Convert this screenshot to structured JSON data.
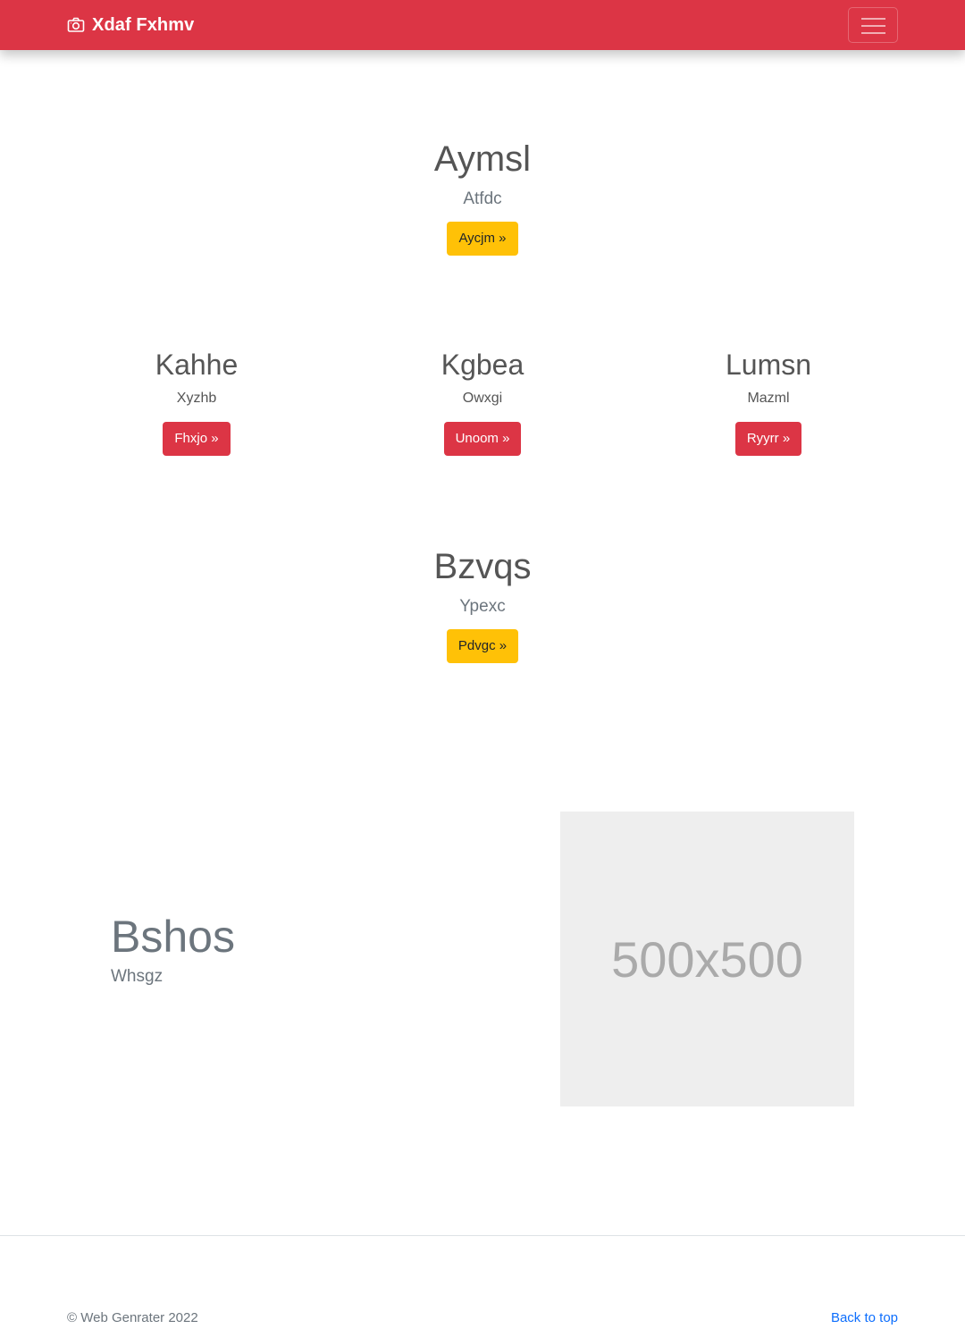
{
  "navbar": {
    "brand": "Xdaf Fxhmv",
    "brand_icon": "camera-icon",
    "toggler_icon": "hamburger-menu-icon",
    "bg_color": "#dc3545"
  },
  "hero1": {
    "title": "Aymsl",
    "subtitle": "Atfdc",
    "button": "Aycjm »"
  },
  "columns": [
    {
      "title": "Kahhe",
      "text": "Xyzhb",
      "button": "Fhxjo »"
    },
    {
      "title": "Kgbea",
      "text": "Owxgi",
      "button": "Unoom »"
    },
    {
      "title": "Lumsn",
      "text": "Mazml",
      "button": "Ryyrr »"
    }
  ],
  "hero2": {
    "title": "Bzvqs",
    "subtitle": "Ypexc",
    "button": "Pdvgc »"
  },
  "feature": {
    "title": "Bshos",
    "subtitle": "Whsgz",
    "image_label": "500x500"
  },
  "footer": {
    "copyright": "© Web Genrater 2022",
    "back_to_top": "Back to top"
  }
}
